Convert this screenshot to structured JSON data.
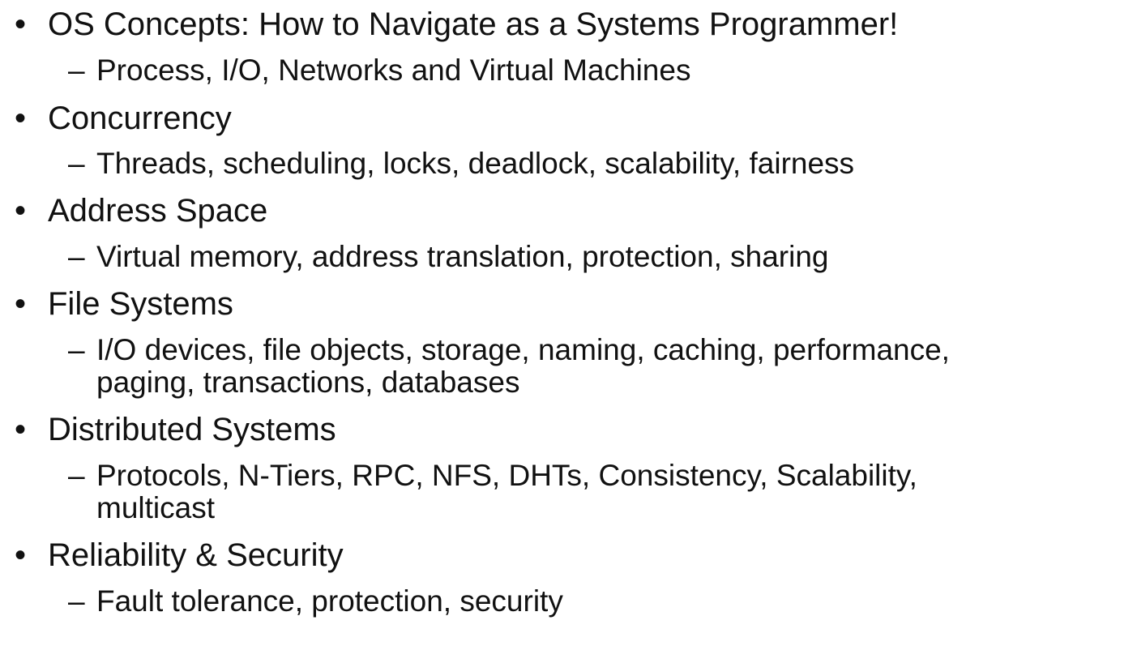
{
  "outline": [
    {
      "title": "OS Concepts: How to Navigate as a Systems Programmer!",
      "detail": [
        "Process, I/O, Networks and Virtual Machines"
      ]
    },
    {
      "title": "Concurrency",
      "detail": [
        "Threads, scheduling, locks, deadlock, scalability, fairness"
      ]
    },
    {
      "title": "Address Space",
      "detail": [
        "Virtual memory, address translation, protection, sharing"
      ]
    },
    {
      "title": "File Systems",
      "detail": [
        "I/O devices, file objects, storage, naming, caching, performance,",
        "paging, transactions, databases"
      ]
    },
    {
      "title": "Distributed Systems",
      "detail": [
        "Protocols, N-Tiers, RPC, NFS, DHTs, Consistency, Scalability,",
        "multicast"
      ]
    },
    {
      "title": "Reliability & Security",
      "detail": [
        "Fault tolerance, protection, security"
      ]
    }
  ],
  "bullet_glyph": "•",
  "dash_glyph": "–"
}
